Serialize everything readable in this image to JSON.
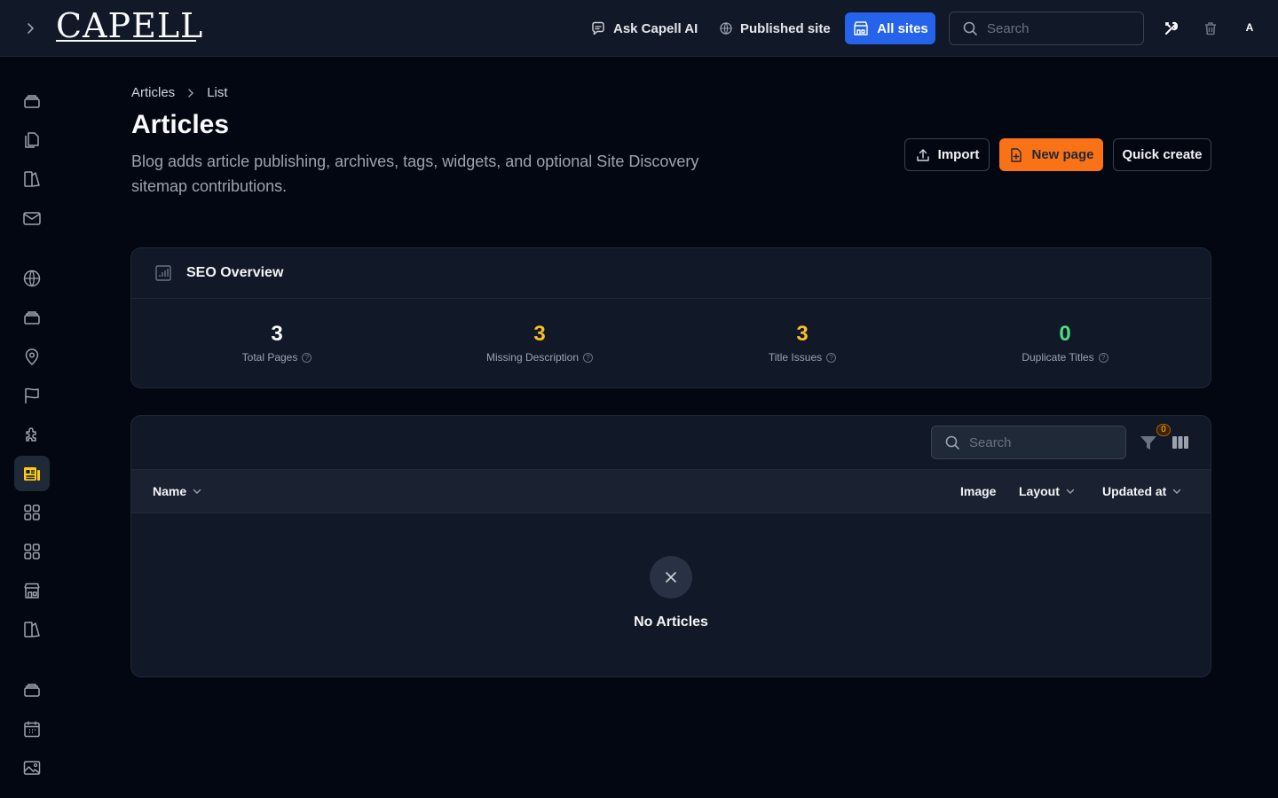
{
  "topbar": {
    "logo": "CAPELL",
    "ask_ai": "Ask Capell AI",
    "published_site": "Published site",
    "all_sites": "All sites",
    "search_placeholder": "Search",
    "avatar_initial": "A"
  },
  "breadcrumb": [
    "Articles",
    "List"
  ],
  "page": {
    "title": "Articles",
    "description": "Blog adds article publishing, archives, tags, widgets, and optional Site Discovery sitemap contributions."
  },
  "actions": {
    "import": "Import",
    "new_page": "New page",
    "quick_create": "Quick create"
  },
  "seo": {
    "title": "SEO Overview",
    "stats": [
      {
        "value": "3",
        "label": "Total Pages",
        "color": "#f9fafb"
      },
      {
        "value": "3",
        "label": "Missing Description",
        "color": "#fbbf24"
      },
      {
        "value": "3",
        "label": "Title Issues",
        "color": "#fbbf24"
      },
      {
        "value": "0",
        "label": "Duplicate Titles",
        "color": "#4ade80"
      }
    ]
  },
  "table": {
    "search_placeholder": "Search",
    "filter_count": "0",
    "columns": {
      "name": "Name",
      "image": "Image",
      "layout": "Layout",
      "updated_at": "Updated at"
    },
    "empty_text": "No Articles"
  },
  "colors": {
    "accent_blue": "#2563eb",
    "accent_orange": "#f97316",
    "active_nav": "#facc15"
  },
  "sidebar_icons": [
    "stack-icon",
    "pages-icon",
    "forms-icon",
    "mail-icon",
    "globe-icon",
    "stack-icon",
    "location-icon",
    "flag-icon",
    "puzzle-icon",
    "newspaper-icon",
    "grid-icon",
    "grid-icon",
    "store-icon",
    "forms-icon",
    "stack-icon",
    "calendar-icon",
    "image-icon"
  ]
}
